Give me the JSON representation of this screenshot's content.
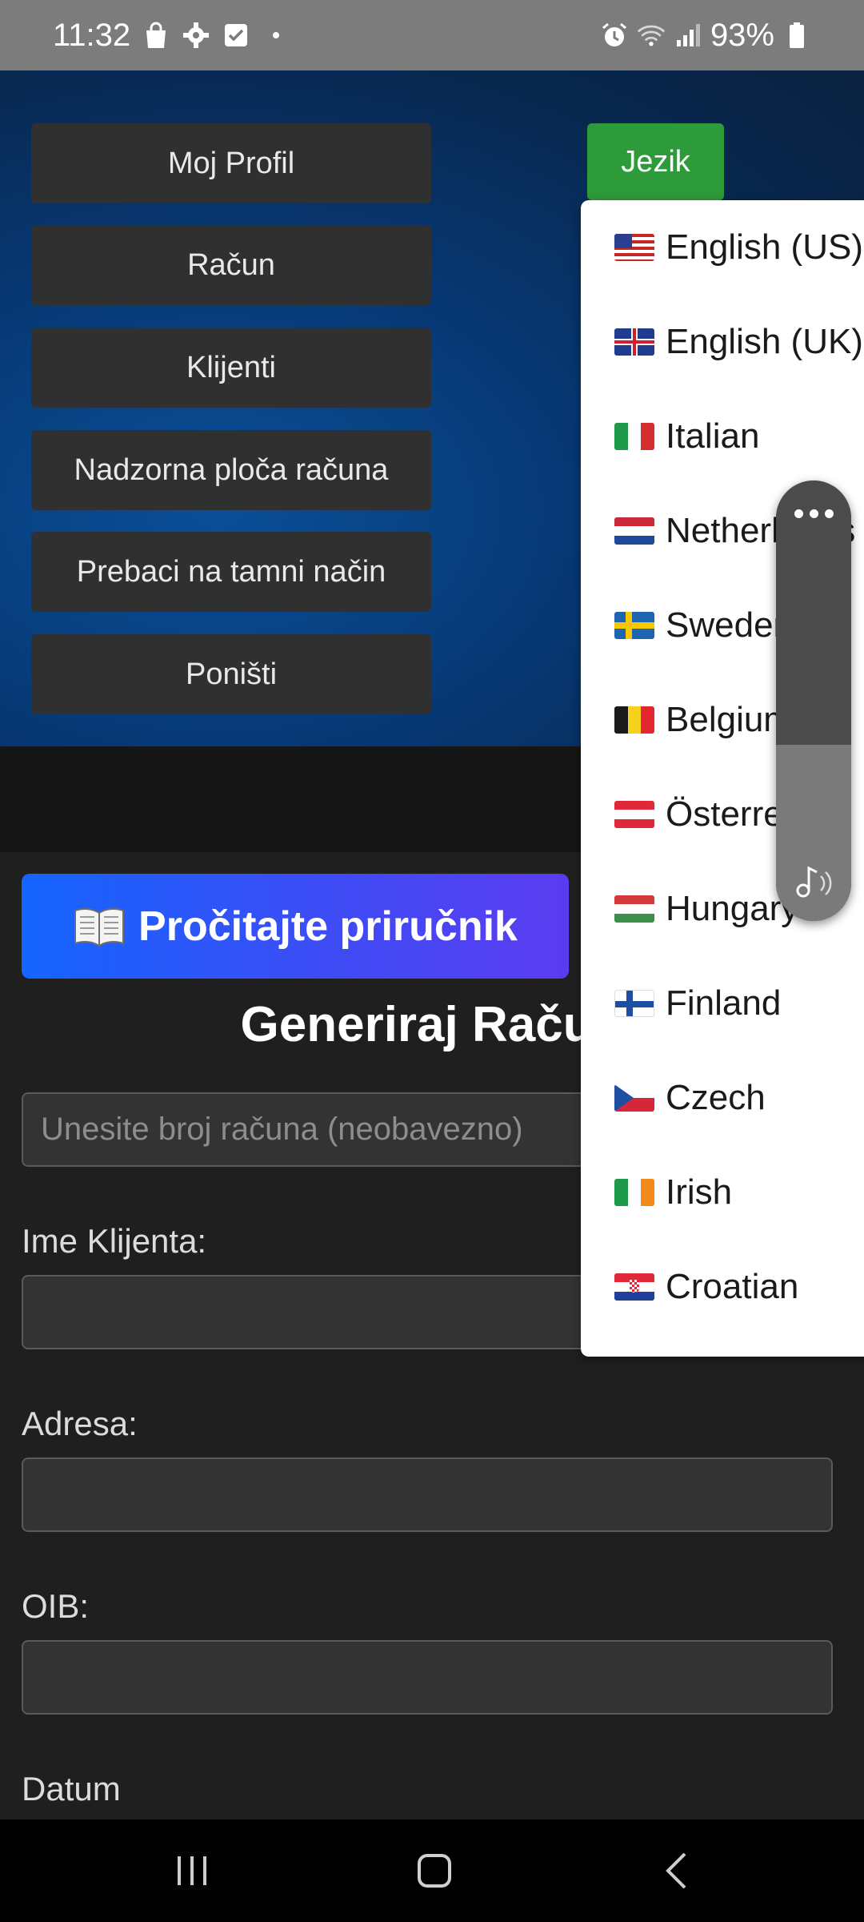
{
  "status_bar": {
    "time": "11:32",
    "battery": "93%",
    "left_icons": [
      "shopping-bag-icon",
      "gear-icon",
      "checkbox-icon",
      "dot-icon"
    ],
    "right_icons": [
      "alarm-icon",
      "wifi-icon",
      "signal-icon",
      "battery-icon"
    ]
  },
  "nav": {
    "items": [
      {
        "label": "Moj Profil"
      },
      {
        "label": "Račun"
      },
      {
        "label": "Klijenti"
      },
      {
        "label": "Nadzorna ploča računa"
      },
      {
        "label": "Prebaci na tamni način"
      },
      {
        "label": "Poništi"
      }
    ],
    "language_button": "Jezik"
  },
  "language_menu": {
    "items": [
      {
        "flag": "us-flag",
        "label": "English (US)"
      },
      {
        "flag": "uk-flag",
        "label": "English (UK)"
      },
      {
        "flag": "italy-flag",
        "label": "Italian"
      },
      {
        "flag": "netherlands-flag",
        "label": "Netherlands"
      },
      {
        "flag": "sweden-flag",
        "label": "Sweden"
      },
      {
        "flag": "belgium-flag",
        "label": "Belgium"
      },
      {
        "flag": "austria-flag",
        "label": "Österreich"
      },
      {
        "flag": "hungary-flag",
        "label": "Hungary"
      },
      {
        "flag": "finland-flag",
        "label": "Finland"
      },
      {
        "flag": "czech-flag",
        "label": "Czech"
      },
      {
        "flag": "ireland-flag",
        "label": "Irish"
      },
      {
        "flag": "croatia-flag",
        "label": "Croatian"
      }
    ]
  },
  "main": {
    "manual_button": "Pročitajte priručnik",
    "manual_icon": "open-book-icon",
    "title": "Generiraj Račun",
    "invoice_number_placeholder": "Unesite broj računa (neobavezno)",
    "client_name_label": "Ime Klijenta:",
    "address_label": "Adresa:",
    "oib_label": "OIB:",
    "date_label": "Datum"
  },
  "volume_panel": {
    "icons": [
      "more-dots-icon",
      "music-note-icon"
    ],
    "level": 0.4
  },
  "nav_bar": {
    "icons": [
      "recent-apps-icon",
      "home-icon",
      "back-icon"
    ]
  },
  "colors": {
    "language_button": "#2d9b3a",
    "nav_button": "#303030",
    "manual_gradient_start": "#1565ff",
    "manual_gradient_end": "#5b3cf0"
  }
}
